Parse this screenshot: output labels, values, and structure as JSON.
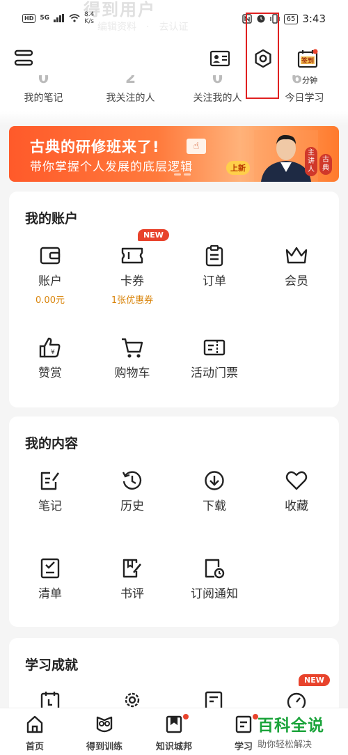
{
  "status_bar": {
    "network_hd": "HD",
    "network_gen": "5G",
    "speed_value": "8.4",
    "speed_unit": "K/s",
    "battery": "65",
    "time": "3:43"
  },
  "header": {
    "faded_title": "得到用户",
    "faded_sub": "编辑资料　·　去认证",
    "checkin_label": "签到"
  },
  "stats": [
    {
      "num": "0",
      "label": "我的笔记"
    },
    {
      "num": "2",
      "label": "我关注的人"
    },
    {
      "num": "0",
      "label": "关注我的人"
    },
    {
      "num": "6",
      "unit": "分钟",
      "label": "今日学习"
    }
  ],
  "banner": {
    "title": "古典的研修班来了!",
    "subtitle": "带你掌握个人发展的底层逻辑",
    "tag": "上新",
    "badge_a": "主讲人",
    "badge_b": "古典"
  },
  "account": {
    "title": "我的账户",
    "items": [
      {
        "label": "账户",
        "sub": "0.00元",
        "icon": "wallet-icon"
      },
      {
        "label": "卡券",
        "sub": "1张优惠券",
        "badge": "NEW",
        "icon": "ticket-icon"
      },
      {
        "label": "订单",
        "icon": "clipboard-icon"
      },
      {
        "label": "会员",
        "icon": "crown-icon"
      },
      {
        "label": "赞赏",
        "icon": "thumbs-up-icon"
      },
      {
        "label": "购物车",
        "icon": "cart-icon"
      },
      {
        "label": "活动门票",
        "icon": "event-ticket-icon"
      }
    ]
  },
  "content": {
    "title": "我的内容",
    "items": [
      {
        "label": "笔记",
        "icon": "note-edit-icon"
      },
      {
        "label": "历史",
        "icon": "history-icon"
      },
      {
        "label": "下载",
        "icon": "download-icon"
      },
      {
        "label": "收藏",
        "icon": "heart-icon"
      },
      {
        "label": "清单",
        "icon": "checklist-icon"
      },
      {
        "label": "书评",
        "icon": "book-review-icon"
      },
      {
        "label": "订阅通知",
        "icon": "subscription-notice-icon"
      }
    ]
  },
  "achievements": {
    "title": "学习成就",
    "badge": "NEW"
  },
  "bottom_nav": [
    {
      "label": "首页",
      "icon": "home-icon"
    },
    {
      "label": "得到训练",
      "icon": "owl-icon"
    },
    {
      "label": "知识城邦",
      "icon": "bookmark-icon",
      "dot": true
    },
    {
      "label": "学习",
      "icon": "study-icon",
      "dot": true
    }
  ],
  "watermark": {
    "title": "百科全说",
    "subtitle": "助你轻松解决"
  },
  "colors": {
    "accent": "#e8432c",
    "highlight": "#e02020",
    "coupon_text": "#d9840a",
    "watermark_green": "#1aa33a"
  }
}
